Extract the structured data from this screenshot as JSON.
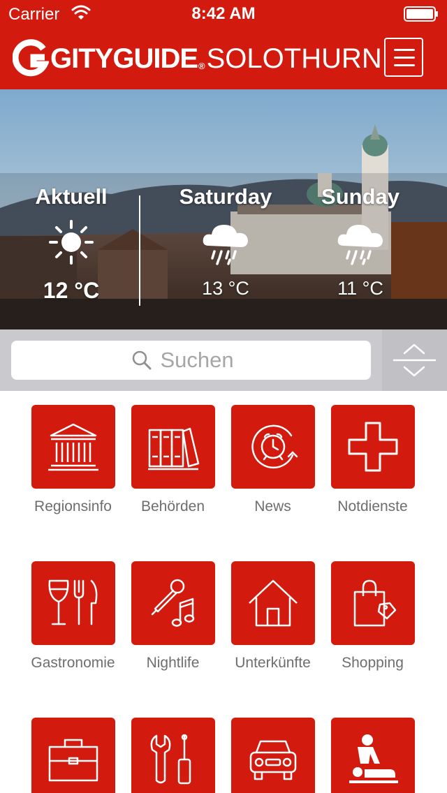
{
  "status_bar": {
    "carrier": "Carrier",
    "time": "8:42 AM"
  },
  "header": {
    "brand": "GITYGUIDE",
    "brand_mark": "®",
    "city": "SOLOTHURN"
  },
  "weather": [
    {
      "day": "Aktuell",
      "icon": "sun-icon",
      "temp": "12 °C"
    },
    {
      "day": "Saturday",
      "icon": "rain-cloud-icon",
      "temp": "13 °C"
    },
    {
      "day": "Sunday",
      "icon": "rain-cloud-icon",
      "temp": "11 °C"
    }
  ],
  "search": {
    "placeholder": "Suchen"
  },
  "categories": [
    {
      "label": "Regionsinfo",
      "icon": "building-icon"
    },
    {
      "label": "Behörden",
      "icon": "binders-icon"
    },
    {
      "label": "News",
      "icon": "alarm-clock-icon"
    },
    {
      "label": "Notdienste",
      "icon": "cross-icon"
    },
    {
      "label": "Gastronomie",
      "icon": "wine-cutlery-icon"
    },
    {
      "label": "Nightlife",
      "icon": "microphone-music-icon"
    },
    {
      "label": "Unterkünfte",
      "icon": "house-icon"
    },
    {
      "label": "Shopping",
      "icon": "shopping-bag-icon"
    },
    {
      "label": "",
      "icon": "briefcase-icon"
    },
    {
      "label": "",
      "icon": "tools-icon"
    },
    {
      "label": "",
      "icon": "car-icon"
    },
    {
      "label": "",
      "icon": "massage-icon"
    }
  ],
  "colors": {
    "accent": "#d21a0e",
    "search_bar": "#c9c9ce",
    "label_text": "#6e6e6e"
  }
}
